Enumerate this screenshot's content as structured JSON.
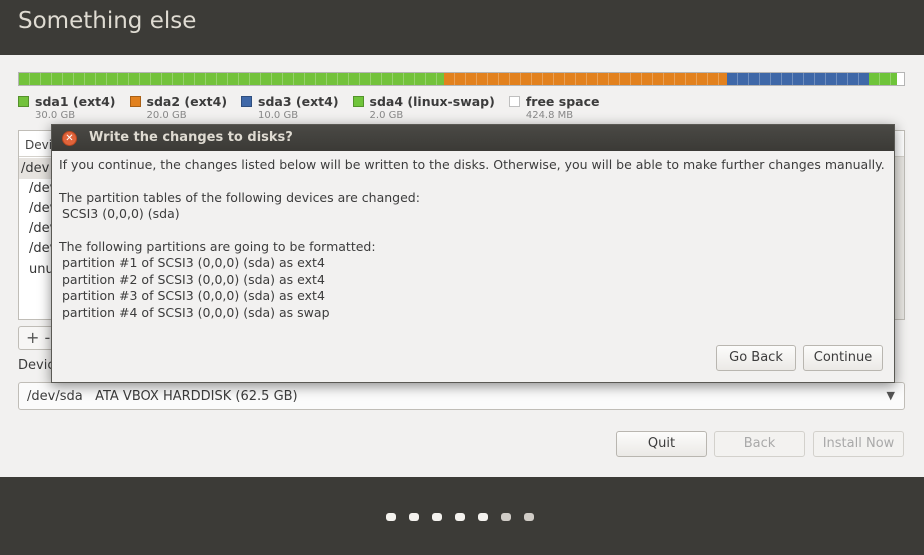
{
  "header": {
    "title": "Something else"
  },
  "partitions": [
    {
      "label": "sda1 (ext4)",
      "size": "30.0 GB",
      "color": "#73c23b",
      "fraction": 0.48
    },
    {
      "label": "sda2 (ext4)",
      "size": "20.0 GB",
      "color": "#e2811e",
      "fraction": 0.32
    },
    {
      "label": "sda3 (ext4)",
      "size": "10.0 GB",
      "color": "#3f68a8",
      "fraction": 0.16
    },
    {
      "label": "sda4 (linux-swap)",
      "size": "2.0 GB",
      "color": "#6fc43a",
      "fraction": 0.032
    },
    {
      "label": "free space",
      "size": "424.8 MB",
      "color": "#ffffff",
      "fraction": 0.008
    }
  ],
  "tree": {
    "header_partial": "Devi",
    "rows": [
      "/dev",
      "/dev",
      "/dev",
      "/dev",
      "/dev",
      "unu"
    ]
  },
  "controls": {
    "add_partial": "+ -"
  },
  "device": {
    "label_partial": "Devic",
    "selected": "/dev/sda   ATA VBOX HARDDISK (62.5 GB)"
  },
  "buttons": {
    "quit": "Quit",
    "back": "Back",
    "install": "Install Now"
  },
  "dialog": {
    "title": "Write the changes to disks?",
    "intro": "If you continue, the changes listed below will be written to the disks. Otherwise, you will be able to make further changes manually.",
    "tables_heading": "The partition tables of the following devices are changed:",
    "tables_devices": [
      "SCSI3 (0,0,0) (sda)"
    ],
    "format_heading": "The following partitions are going to be formatted:",
    "format_list": [
      "partition #1 of SCSI3 (0,0,0) (sda) as ext4",
      "partition #2 of SCSI3 (0,0,0) (sda) as ext4",
      "partition #3 of SCSI3 (0,0,0) (sda) as ext4",
      "partition #4 of SCSI3 (0,0,0) (sda) as swap"
    ],
    "go_back": "Go Back",
    "continue": "Continue"
  },
  "progress": {
    "total_steps": 7,
    "current_step": 5
  }
}
